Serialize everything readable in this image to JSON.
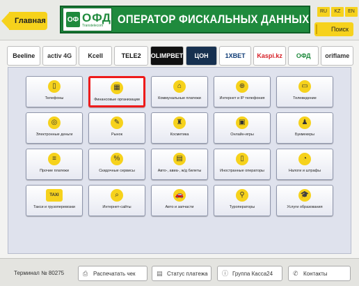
{
  "header": {
    "back_label": "Главная",
    "logo_mark": "ОФ",
    "logo_text": "ОФД",
    "logo_sub": "Transtelecom",
    "title": "ОПЕРАТОР ФИСКАЛЬНЫХ ДАННЫХ",
    "languages": [
      "RU",
      "KZ",
      "EN"
    ],
    "search_label": "Поиск"
  },
  "partners": [
    {
      "label": "Beeline",
      "bg": "#ffffff",
      "color": "#222222"
    },
    {
      "label": "activ 4G",
      "bg": "#ffffff",
      "color": "#333333"
    },
    {
      "label": "Kcell",
      "bg": "#ffffff",
      "color": "#222222"
    },
    {
      "label": "TELE2",
      "bg": "#ffffff",
      "color": "#111111"
    },
    {
      "label": "OLIMPBET",
      "bg": "#101010",
      "color": "#ffffff"
    },
    {
      "label": "ЦОН",
      "bg": "#16304f",
      "color": "#ffffff"
    },
    {
      "label": "1XBET",
      "bg": "#ffffff",
      "color": "#0d3b75"
    },
    {
      "label": "Kaspi.kz",
      "bg": "#ffffff",
      "color": "#d61f26"
    },
    {
      "label": "ОФД",
      "bg": "#ffffff",
      "color": "#1f8a3d"
    },
    {
      "label": "oriflame",
      "bg": "#ffffff",
      "color": "#333333"
    }
  ],
  "services": [
    {
      "label": "Телефоны",
      "icon": "phone-icon",
      "glyph": "▯"
    },
    {
      "label": "Финансовые организации",
      "icon": "building-icon",
      "glyph": "▦",
      "selected": true
    },
    {
      "label": "Коммунальные платежи",
      "icon": "house-icon",
      "glyph": "⌂"
    },
    {
      "label": "Интернет и IP телефония",
      "icon": "globe-icon",
      "glyph": "⊕"
    },
    {
      "label": "Телевидение",
      "icon": "tv-icon",
      "glyph": "▭"
    },
    {
      "label": "Электронные деньги",
      "icon": "coins-icon",
      "glyph": "◎"
    },
    {
      "label": "Рынок",
      "icon": "market-icon",
      "glyph": "✎"
    },
    {
      "label": "Косметика",
      "icon": "cosmetics-icon",
      "glyph": "♜"
    },
    {
      "label": "Онлайн-игры",
      "icon": "gamepad-icon",
      "glyph": "▣"
    },
    {
      "label": "Букмекеры",
      "icon": "bookmaker-icon",
      "glyph": "♟"
    },
    {
      "label": "Прочие платежи",
      "icon": "list-icon",
      "glyph": "≡"
    },
    {
      "label": "Скидочные сервисы",
      "icon": "discount-icon",
      "glyph": "%"
    },
    {
      "label": "Авто-, авиа-, ж/д билеты",
      "icon": "train-icon",
      "glyph": "▤"
    },
    {
      "label": "Иностранные операторы",
      "icon": "mobile-icon",
      "glyph": "▯"
    },
    {
      "label": "Налоги и штрафы",
      "icon": "pie-chart-icon",
      "glyph": "◔"
    },
    {
      "label": "Такси и грузоперевозки",
      "icon": "taxi-icon",
      "glyph": "TAXI"
    },
    {
      "label": "Интернет-сайты",
      "icon": "magnifier-icon",
      "glyph": "⌕"
    },
    {
      "label": "Авто и запчасти",
      "icon": "car-icon",
      "glyph": "🚗"
    },
    {
      "label": "Туроператоры",
      "icon": "location-pin-icon",
      "glyph": "⚲"
    },
    {
      "label": "Услуги образования",
      "icon": "graduation-cap-icon",
      "glyph": "🎓"
    }
  ],
  "footer": {
    "terminal": "Терминал № 80275",
    "print_label": "Распечатать чек",
    "status_label": "Статус платежа",
    "group_label": "Группа Касса24",
    "contacts_label": "Контакты"
  }
}
